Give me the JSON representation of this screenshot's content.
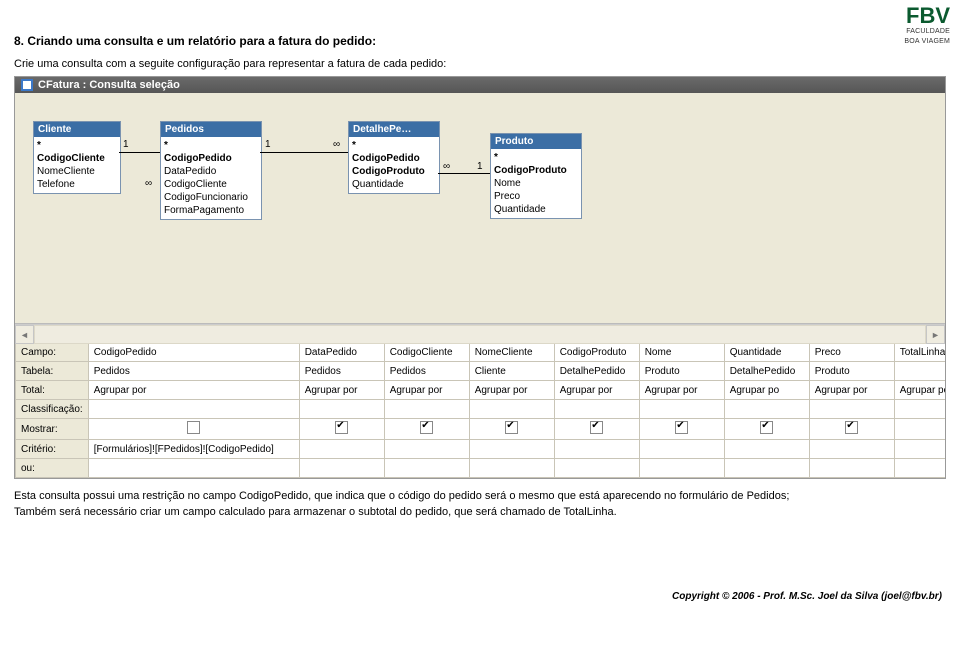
{
  "logo": {
    "main": "FBV",
    "sub1": "FACULDADE",
    "sub2": "BOA VIAGEM"
  },
  "heading": "8.  Criando uma consulta e um relatório para a fatura do pedido:",
  "intro": "Crie uma consulta com a seguite configuração para representar a fatura de cada pedido:",
  "window": {
    "title": "CFatura : Consulta seleção"
  },
  "tables": {
    "cliente": {
      "title": "Cliente",
      "fields": [
        "*",
        "CodigoCliente",
        "NomeCliente",
        "Telefone"
      ]
    },
    "pedidos": {
      "title": "Pedidos",
      "fields": [
        "*",
        "CodigoPedido",
        "DataPedido",
        "CodigoCliente",
        "CodigoFuncionario",
        "FormaPagamento"
      ]
    },
    "detalhepe": {
      "title": "DetalhePe…",
      "fields": [
        "*",
        "CodigoPedido",
        "CodigoProduto",
        "Quantidade"
      ]
    },
    "produto": {
      "title": "Produto",
      "fields": [
        "*",
        "CodigoProduto",
        "Nome",
        "Preco",
        "Quantidade"
      ]
    }
  },
  "relations": {
    "one": "1",
    "inf": "∞"
  },
  "qbe_rows": {
    "campo": "Campo:",
    "tabela": "Tabela:",
    "total": "Total:",
    "classif": "Classificação:",
    "mostrar": "Mostrar:",
    "criterio": "Critério:",
    "ou": "ou:"
  },
  "cols": [
    {
      "campo": "CodigoPedido",
      "tabela": "Pedidos",
      "total": "Agrupar por",
      "mostrar": false,
      "criterio": "[Formulários]![FPedidos]![CodigoPedido]"
    },
    {
      "campo": "DataPedido",
      "tabela": "Pedidos",
      "total": "Agrupar por",
      "mostrar": true,
      "criterio": ""
    },
    {
      "campo": "CodigoCliente",
      "tabela": "Pedidos",
      "total": "Agrupar por",
      "mostrar": true,
      "criterio": ""
    },
    {
      "campo": "NomeCliente",
      "tabela": "Cliente",
      "total": "Agrupar por",
      "mostrar": true,
      "criterio": ""
    },
    {
      "campo": "CodigoProduto",
      "tabela": "DetalhePedido",
      "total": "Agrupar por",
      "mostrar": true,
      "criterio": ""
    },
    {
      "campo": "Nome",
      "tabela": "Produto",
      "total": "Agrupar por",
      "mostrar": true,
      "criterio": ""
    },
    {
      "campo": "Quantidade",
      "tabela": "DetalhePedido",
      "total": "Agrupar po",
      "mostrar": true,
      "criterio": ""
    },
    {
      "campo": "Preco",
      "tabela": "Produto",
      "total": "Agrupar por",
      "mostrar": true,
      "criterio": ""
    },
    {
      "campo": "TotalLinha: (DetalhePedido.Quantidade*[Preco])",
      "tabela": "",
      "total": "Agrupar por",
      "mostrar": true,
      "criterio": ""
    }
  ],
  "explain_line": "Esta consulta possui uma restrição no campo CodigoPedido, que indica que o código do pedido será o mesmo que está aparecendo no formulário de Pedidos;",
  "explain_line2": "Também será necessário criar um campo calculado para armazenar o subtotal do pedido, que será chamado de TotalLinha.",
  "footer": "Copyright © 2006 - Prof. M.Sc. Joel da Silva (joel@fbv.br)"
}
